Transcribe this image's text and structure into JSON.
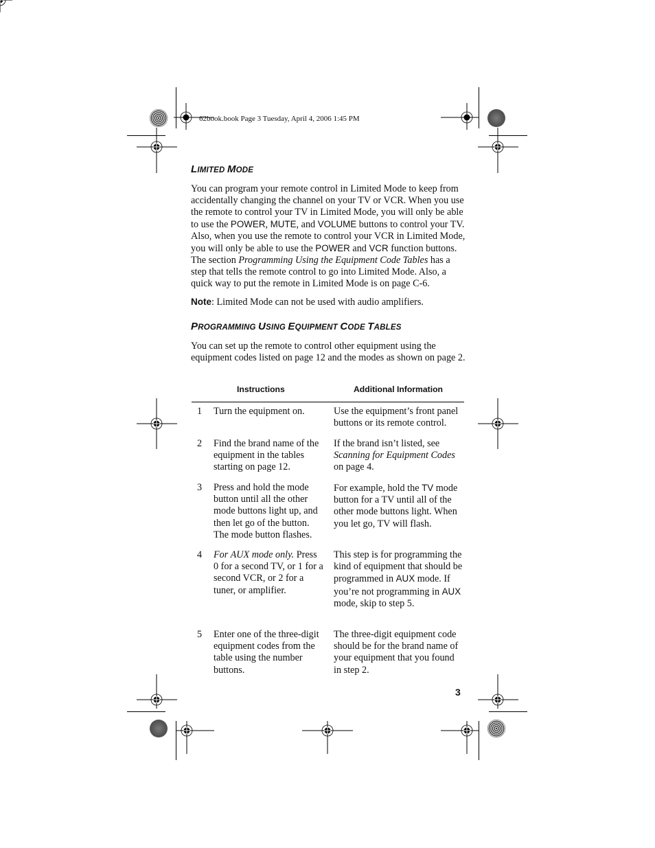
{
  "header": {
    "print_slug": "62book.book  Page 3  Tuesday, April 4, 2006  1:45 PM"
  },
  "sections": {
    "limited_mode": {
      "title_first": "L",
      "title_rest1": "imited ",
      "title_second": "M",
      "title_rest2": "ode",
      "paragraph": {
        "p1": "You can program your remote control in Limited Mode to keep from accidentally changing the channel on your TV or VCR. When you use the remote to control your TV in Limited Mode, you will only be able to use the ",
        "kw_power": "POWER",
        "sep1": ", ",
        "kw_mute": "MUTE",
        "sep2": ", and ",
        "kw_volume": "VOLUME",
        "p2": " buttons to control your TV. Also, when you use the remote to control your VCR in Limited Mode, you will only be able to use the ",
        "kw_power2": "POWER",
        "sep3": " and ",
        "kw_vcr": "VCR",
        "p3": " function buttons. The section ",
        "italic_ref": "Programming Using the Equipment Code Tables",
        "p4": " has a step that tells the remote control to go into Limited Mode. Also, a quick way to put the remote in Limited Mode is on page C-6."
      },
      "note_label": "Note",
      "note_text": ": Limited Mode can not be used with audio amplifiers."
    },
    "programming": {
      "title_parts": [
        {
          "cap": "P",
          "rest": "rogramming "
        },
        {
          "cap": "U",
          "rest": "sing "
        },
        {
          "cap": "E",
          "rest": "quipment "
        },
        {
          "cap": "C",
          "rest": "ode "
        },
        {
          "cap": "T",
          "rest": "ables"
        }
      ],
      "intro": "You can set up the remote to control other equipment using the equipment codes listed on page 12 and the modes as shown on page 2.",
      "table": {
        "headers": [
          "Instructions",
          "Additional Information"
        ],
        "rows": [
          {
            "num": "1",
            "instruction": "Turn the equipment on.",
            "info": "Use the equipment’s front panel buttons or its remote control."
          },
          {
            "num": "2",
            "instruction": "Find the brand name of the equipment in the tables starting on page 12.",
            "info_pre": "If the brand isn’t listed, see ",
            "info_italic": "Scanning for Equipment Codes",
            "info_post": " on page 4."
          },
          {
            "num": "3",
            "instruction": "Press and hold the mode button until all the other mode buttons light up, and then let go of the button. The mode button flashes.",
            "info_pre": "For example, hold the ",
            "info_kw": "TV",
            "info_post": " mode button for a TV until all of the other mode buttons light. When you let go, TV will flash."
          },
          {
            "num": "4",
            "instruction_italic": "For AUX mode only.",
            "instruction_post": " Press 0 for a second TV, or 1 for a second VCR, or 2 for a tuner, or amplifier.",
            "info_pre": "This step is for programming the kind of equipment that should be programmed in ",
            "info_kw": "AUX",
            "info_mid": " mode. If you’re not programming in ",
            "info_kw2": "AUX",
            "info_post": " mode, skip to step 5."
          },
          {
            "num": "5",
            "instruction": "Enter one of the three-digit equipment codes from the table using the number buttons.",
            "info": "The three-digit equipment code should be for the brand name of your equipment that you found in step 2."
          }
        ]
      }
    }
  },
  "footer": {
    "page_number": "3"
  }
}
